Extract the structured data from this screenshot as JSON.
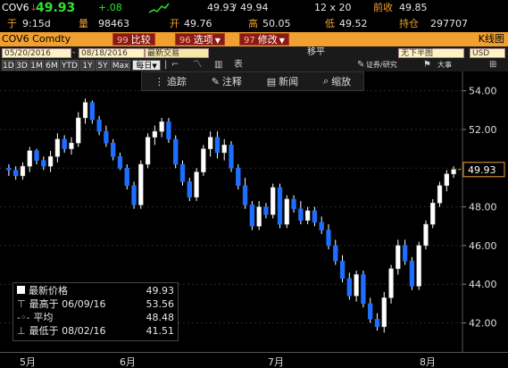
{
  "quote": {
    "ticker": "COV6",
    "price": "49.93",
    "change": "+.08",
    "bid": "49.93",
    "ask": "49.94",
    "size": "12 x 20",
    "prev_close_label": "前收",
    "prev_close": "49.85",
    "time_label": "于",
    "time": "9:15d",
    "volume_label": "量",
    "volume": "98463",
    "open_label": "开",
    "open": "49.76",
    "high_label": "高",
    "high": "50.05",
    "low_label": "低",
    "low": "49.52",
    "oi_label": "持仓",
    "oi": "297707"
  },
  "command_bar": {
    "security": "COV6 Comdty",
    "compare_num": "99",
    "compare": "比较",
    "options_num": "96",
    "options": "选项",
    "edit_num": "97",
    "edit": "修改",
    "chart_type": "K线图"
  },
  "params": {
    "start_date": "05/20/2016",
    "end_date": "08/18/2016",
    "last_trade": "最新交易",
    "frequency": "移平",
    "mode": "无下半图",
    "currency": "USD"
  },
  "periods": [
    "1D",
    "3D",
    "1M",
    "6M",
    "YTD",
    "1Y",
    "5Y",
    "Max"
  ],
  "period_extra": [
    "每日",
    "表"
  ],
  "right_tools": [
    "证券/研究",
    "大事"
  ],
  "toolbar": {
    "track": "追踪",
    "annotate": "注释",
    "news": "新闻",
    "zoom": "缩放"
  },
  "legend": {
    "last_label": "最新价格",
    "last": "49.93",
    "high_label": "最高于 06/09/16",
    "high": "53.56",
    "avg_label": "平均",
    "avg": "48.48",
    "low_label": "最低于 08/02/16",
    "low": "41.51"
  },
  "colors": {
    "up": "#ffffff",
    "down": "#1e6fff",
    "accent": "#f0a030"
  },
  "chart_data": {
    "type": "candlestick",
    "y_ticks": [
      "54.00",
      "52.00",
      "50.00",
      "48.00",
      "46.00",
      "44.00",
      "42.00"
    ],
    "ylim": [
      40.5,
      55.0
    ],
    "x_labels": [
      "5月",
      "6月",
      "7月",
      "8月"
    ],
    "last_price_tag": "49.93",
    "candles": [
      [
        50.0,
        50.2,
        49.6,
        49.9
      ],
      [
        49.9,
        50.1,
        49.4,
        49.6
      ],
      [
        49.6,
        50.3,
        49.4,
        50.1
      ],
      [
        50.1,
        51.1,
        49.8,
        50.9
      ],
      [
        50.9,
        51.0,
        50.2,
        50.4
      ],
      [
        50.4,
        50.6,
        49.9,
        50.1
      ],
      [
        50.1,
        50.9,
        49.8,
        50.6
      ],
      [
        50.6,
        51.8,
        50.3,
        51.5
      ],
      [
        51.5,
        51.7,
        50.8,
        51.0
      ],
      [
        51.0,
        51.6,
        50.7,
        51.3
      ],
      [
        51.3,
        52.9,
        51.1,
        52.6
      ],
      [
        52.6,
        53.6,
        52.3,
        53.4
      ],
      [
        53.4,
        53.5,
        52.3,
        52.5
      ],
      [
        52.5,
        52.7,
        51.7,
        51.9
      ],
      [
        51.9,
        52.2,
        51.1,
        51.3
      ],
      [
        51.3,
        51.5,
        50.4,
        50.6
      ],
      [
        50.6,
        50.8,
        49.9,
        50.0
      ],
      [
        50.0,
        50.2,
        48.9,
        49.1
      ],
      [
        49.1,
        49.3,
        47.9,
        48.1
      ],
      [
        48.1,
        50.4,
        47.9,
        50.2
      ],
      [
        50.2,
        51.8,
        50.0,
        51.6
      ],
      [
        51.6,
        52.2,
        51.2,
        51.9
      ],
      [
        51.9,
        52.6,
        51.6,
        52.4
      ],
      [
        52.4,
        52.6,
        51.3,
        51.5
      ],
      [
        51.5,
        51.7,
        50.0,
        50.2
      ],
      [
        50.2,
        50.4,
        49.1,
        49.3
      ],
      [
        49.3,
        49.5,
        48.3,
        48.5
      ],
      [
        48.5,
        50.0,
        48.3,
        49.8
      ],
      [
        49.8,
        51.2,
        49.6,
        51.0
      ],
      [
        51.0,
        51.9,
        50.6,
        51.6
      ],
      [
        51.6,
        51.9,
        50.5,
        50.8
      ],
      [
        50.8,
        51.5,
        50.4,
        51.2
      ],
      [
        51.2,
        51.4,
        49.8,
        50.0
      ],
      [
        50.0,
        50.2,
        48.9,
        49.1
      ],
      [
        49.1,
        49.5,
        47.9,
        48.1
      ],
      [
        48.1,
        48.3,
        46.8,
        47.0
      ],
      [
        47.0,
        48.3,
        46.8,
        48.0
      ],
      [
        48.0,
        48.2,
        47.4,
        47.6
      ],
      [
        47.6,
        49.2,
        47.4,
        49.0
      ],
      [
        49.0,
        49.2,
        46.9,
        47.1
      ],
      [
        47.1,
        48.6,
        46.9,
        48.4
      ],
      [
        48.4,
        48.6,
        47.7,
        47.9
      ],
      [
        47.9,
        48.3,
        47.1,
        47.3
      ],
      [
        47.3,
        48.0,
        47.1,
        47.8
      ],
      [
        47.8,
        48.0,
        47.0,
        47.2
      ],
      [
        47.2,
        47.5,
        46.6,
        46.8
      ],
      [
        46.8,
        47.1,
        45.8,
        46.0
      ],
      [
        46.0,
        46.3,
        45.0,
        45.2
      ],
      [
        45.2,
        45.5,
        44.1,
        44.3
      ],
      [
        44.3,
        44.6,
        43.2,
        43.4
      ],
      [
        43.4,
        44.7,
        43.1,
        44.5
      ],
      [
        44.5,
        44.7,
        42.8,
        43.0
      ],
      [
        43.0,
        43.3,
        42.0,
        42.2
      ],
      [
        42.2,
        42.5,
        41.6,
        41.8
      ],
      [
        41.8,
        43.6,
        41.5,
        43.3
      ],
      [
        43.3,
        45.0,
        43.0,
        44.8
      ],
      [
        44.8,
        46.3,
        44.5,
        46.0
      ],
      [
        46.0,
        46.3,
        45.0,
        45.2
      ],
      [
        45.2,
        45.4,
        43.7,
        43.9
      ],
      [
        43.9,
        46.2,
        43.7,
        46.0
      ],
      [
        46.0,
        47.3,
        45.8,
        47.1
      ],
      [
        47.1,
        48.4,
        46.9,
        48.2
      ],
      [
        48.2,
        49.3,
        48.0,
        49.1
      ],
      [
        49.1,
        49.9,
        48.8,
        49.7
      ],
      [
        49.7,
        50.1,
        49.5,
        49.93
      ]
    ]
  }
}
